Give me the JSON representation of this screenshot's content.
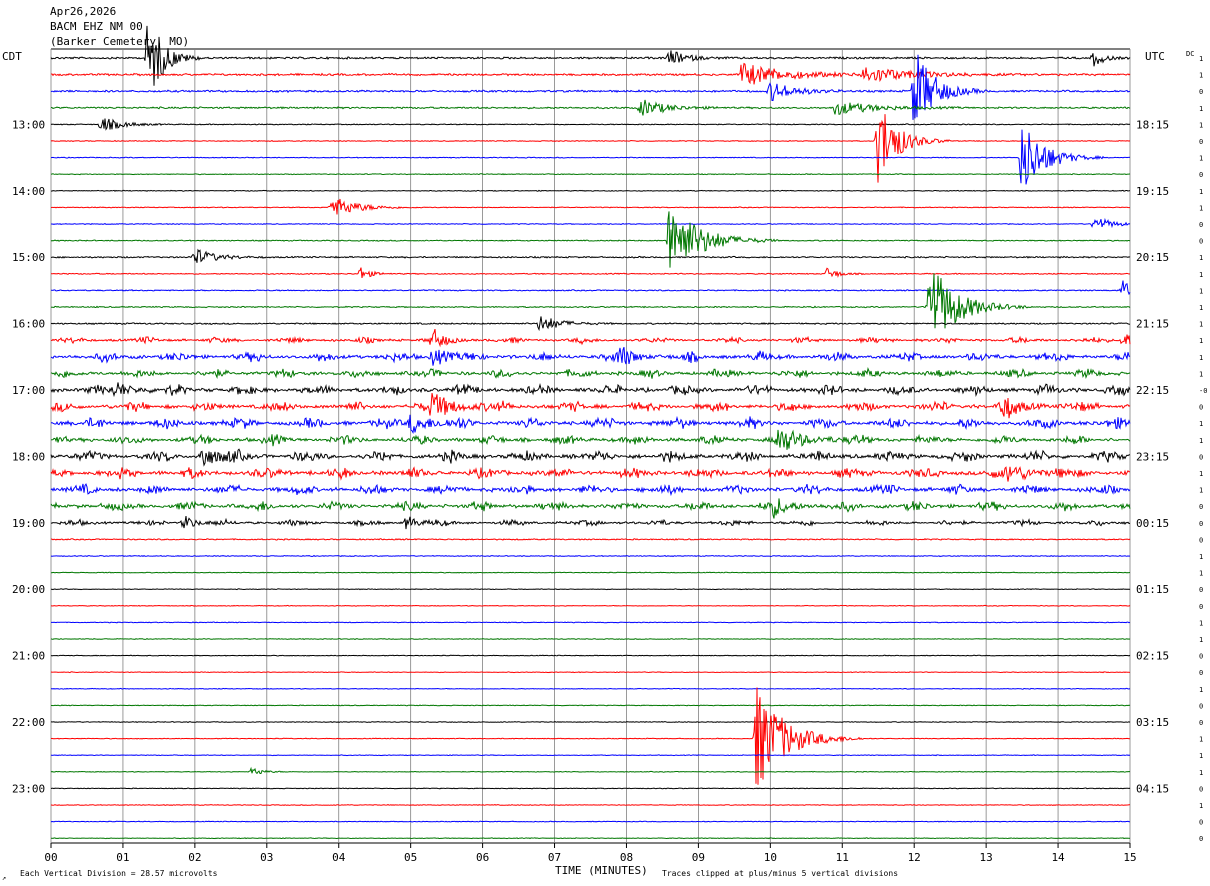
{
  "header": {
    "date": "Apr26,2026",
    "station": "BACM EHZ NM 00",
    "location": "(Barker Cemetery, MO)"
  },
  "left_tz": "CDT",
  "right_tz": "UTC",
  "footer": {
    "xlabel": "TIME (MINUTES)",
    "scale_note": "Each Vertical Division =   28.57 microvolts",
    "clip_note": "Traces clipped at plus/minus 5 vertical divisions",
    "corner_mark": "↗"
  },
  "chart_data": {
    "type": "line",
    "title": "BACM EHZ NM 00 (Barker Cemetery, MO)",
    "xlabel": "TIME (MINUTES)",
    "x_ticks": [
      "00",
      "01",
      "02",
      "03",
      "04",
      "05",
      "06",
      "07",
      "08",
      "09",
      "10",
      "11",
      "12",
      "13",
      "14",
      "15"
    ],
    "xlim": [
      0,
      15
    ],
    "trace_count": 48,
    "trace_colors": [
      "#000000",
      "#ff0000",
      "#0000ff",
      "#007700"
    ],
    "left_hour_labels": [
      {
        "row": 4,
        "label": "13:00"
      },
      {
        "row": 8,
        "label": "14:00"
      },
      {
        "row": 12,
        "label": "15:00"
      },
      {
        "row": 16,
        "label": "16:00"
      },
      {
        "row": 20,
        "label": "17:00"
      },
      {
        "row": 24,
        "label": "18:00"
      },
      {
        "row": 28,
        "label": "19:00"
      },
      {
        "row": 32,
        "label": "20:00"
      },
      {
        "row": 36,
        "label": "21:00"
      },
      {
        "row": 40,
        "label": "22:00"
      },
      {
        "row": 44,
        "label": "23:00"
      }
    ],
    "right_hour_labels": [
      {
        "row": 4,
        "label": "18:15"
      },
      {
        "row": 8,
        "label": "19:15"
      },
      {
        "row": 12,
        "label": "20:15"
      },
      {
        "row": 16,
        "label": "21:15"
      },
      {
        "row": 20,
        "label": "22:15"
      },
      {
        "row": 24,
        "label": "23:15"
      },
      {
        "row": 28,
        "label": "00:15"
      },
      {
        "row": 32,
        "label": "01:15"
      },
      {
        "row": 36,
        "label": "02:15"
      },
      {
        "row": 40,
        "label": "03:15"
      },
      {
        "row": 44,
        "label": "04:15"
      }
    ],
    "dc_header": "DC",
    "dc_offsets": [
      "1",
      "1",
      "0",
      "1",
      "1",
      "0",
      "1",
      "0",
      "1",
      "1",
      "0",
      "0",
      "1",
      "1",
      "1",
      "1",
      "1",
      "1",
      "1",
      "1",
      "-0",
      "0",
      "1",
      "1",
      "0",
      "1",
      "1",
      "0",
      "0",
      "0",
      "1",
      "1",
      "0",
      "0",
      "1",
      "1",
      "0",
      "0",
      "1",
      "0",
      "0",
      "1",
      "1",
      "1",
      "0",
      "1",
      "0",
      "0"
    ],
    "noise_level": [
      0.8,
      0.8,
      0.8,
      0.7,
      0.4,
      0.35,
      0.35,
      0.35,
      0.35,
      0.35,
      0.35,
      0.45,
      0.6,
      0.45,
      0.5,
      0.5,
      0.6,
      0.9,
      1.4,
      1.3,
      1.5,
      1.5,
      1.6,
      1.4,
      1.6,
      1.6,
      1.5,
      1.4,
      0.9,
      0.5,
      0.35,
      0.3,
      0.3,
      0.3,
      0.3,
      0.3,
      0.3,
      0.3,
      0.3,
      0.3,
      0.3,
      0.3,
      0.3,
      0.3,
      0.3,
      0.3,
      0.3,
      0.3
    ],
    "events": [
      {
        "row": 0,
        "minute": 1.35,
        "amp": 48,
        "dur": 0.3,
        "clip": true
      },
      {
        "row": 0,
        "minute": 8.6,
        "amp": 8,
        "dur": 0.35
      },
      {
        "row": 0,
        "minute": 14.5,
        "amp": 9,
        "dur": 0.2
      },
      {
        "row": 1,
        "minute": 9.6,
        "amp": 12,
        "dur": 0.9
      },
      {
        "row": 1,
        "minute": 11.3,
        "amp": 8,
        "dur": 1.0
      },
      {
        "row": 2,
        "minute": 10.0,
        "amp": 10,
        "dur": 0.5
      },
      {
        "row": 2,
        "minute": 12.0,
        "amp": 45,
        "dur": 0.4,
        "clip": true
      },
      {
        "row": 3,
        "minute": 8.2,
        "amp": 9,
        "dur": 0.5
      },
      {
        "row": 3,
        "minute": 10.9,
        "amp": 7,
        "dur": 0.8
      },
      {
        "row": 4,
        "minute": 0.7,
        "amp": 8,
        "dur": 0.4
      },
      {
        "row": 5,
        "minute": 11.5,
        "amp": 45,
        "dur": 0.4,
        "clip": true
      },
      {
        "row": 6,
        "minute": 13.5,
        "amp": 40,
        "dur": 0.45,
        "clip": true
      },
      {
        "row": 9,
        "minute": 3.9,
        "amp": 12,
        "dur": 0.5
      },
      {
        "row": 10,
        "minute": 14.5,
        "amp": 8,
        "dur": 0.35
      },
      {
        "row": 11,
        "minute": 8.6,
        "amp": 42,
        "dur": 0.6,
        "clip": true
      },
      {
        "row": 12,
        "minute": 2.0,
        "amp": 9,
        "dur": 0.4
      },
      {
        "row": 13,
        "minute": 4.3,
        "amp": 7,
        "dur": 0.2
      },
      {
        "row": 13,
        "minute": 10.8,
        "amp": 7,
        "dur": 0.2
      },
      {
        "row": 14,
        "minute": 14.9,
        "amp": 10,
        "dur": 0.2
      },
      {
        "row": 15,
        "minute": 12.2,
        "amp": 48,
        "dur": 0.55,
        "clip": true
      },
      {
        "row": 16,
        "minute": 6.8,
        "amp": 9,
        "dur": 0.4
      },
      {
        "row": 17,
        "minute": 5.3,
        "amp": 10,
        "dur": 0.25
      },
      {
        "row": 17,
        "minute": 14.9,
        "amp": 11,
        "dur": 0.2
      },
      {
        "row": 18,
        "minute": 5.3,
        "amp": 10,
        "dur": 0.3
      },
      {
        "row": 18,
        "minute": 7.9,
        "amp": 10,
        "dur": 0.3
      },
      {
        "row": 20,
        "minute": 0.9,
        "amp": 8,
        "dur": 0.3
      },
      {
        "row": 21,
        "minute": 5.3,
        "amp": 13,
        "dur": 0.45
      },
      {
        "row": 21,
        "minute": 13.2,
        "amp": 9,
        "dur": 0.4
      },
      {
        "row": 22,
        "minute": 5.0,
        "amp": 10,
        "dur": 0.4
      },
      {
        "row": 23,
        "minute": 10.1,
        "amp": 10,
        "dur": 0.6
      },
      {
        "row": 24,
        "minute": 2.1,
        "amp": 12,
        "dur": 0.3
      },
      {
        "row": 25,
        "minute": 13.3,
        "amp": 9,
        "dur": 0.5
      },
      {
        "row": 27,
        "minute": 10.0,
        "amp": 9,
        "dur": 0.4
      },
      {
        "row": 28,
        "minute": 1.85,
        "amp": 8,
        "dur": 0.2
      },
      {
        "row": 28,
        "minute": 4.95,
        "amp": 8,
        "dur": 0.2
      },
      {
        "row": 41,
        "minute": 9.8,
        "amp": 55,
        "dur": 0.6,
        "clip": true
      },
      {
        "row": 43,
        "minute": 2.8,
        "amp": 5,
        "dur": 0.2
      }
    ]
  }
}
